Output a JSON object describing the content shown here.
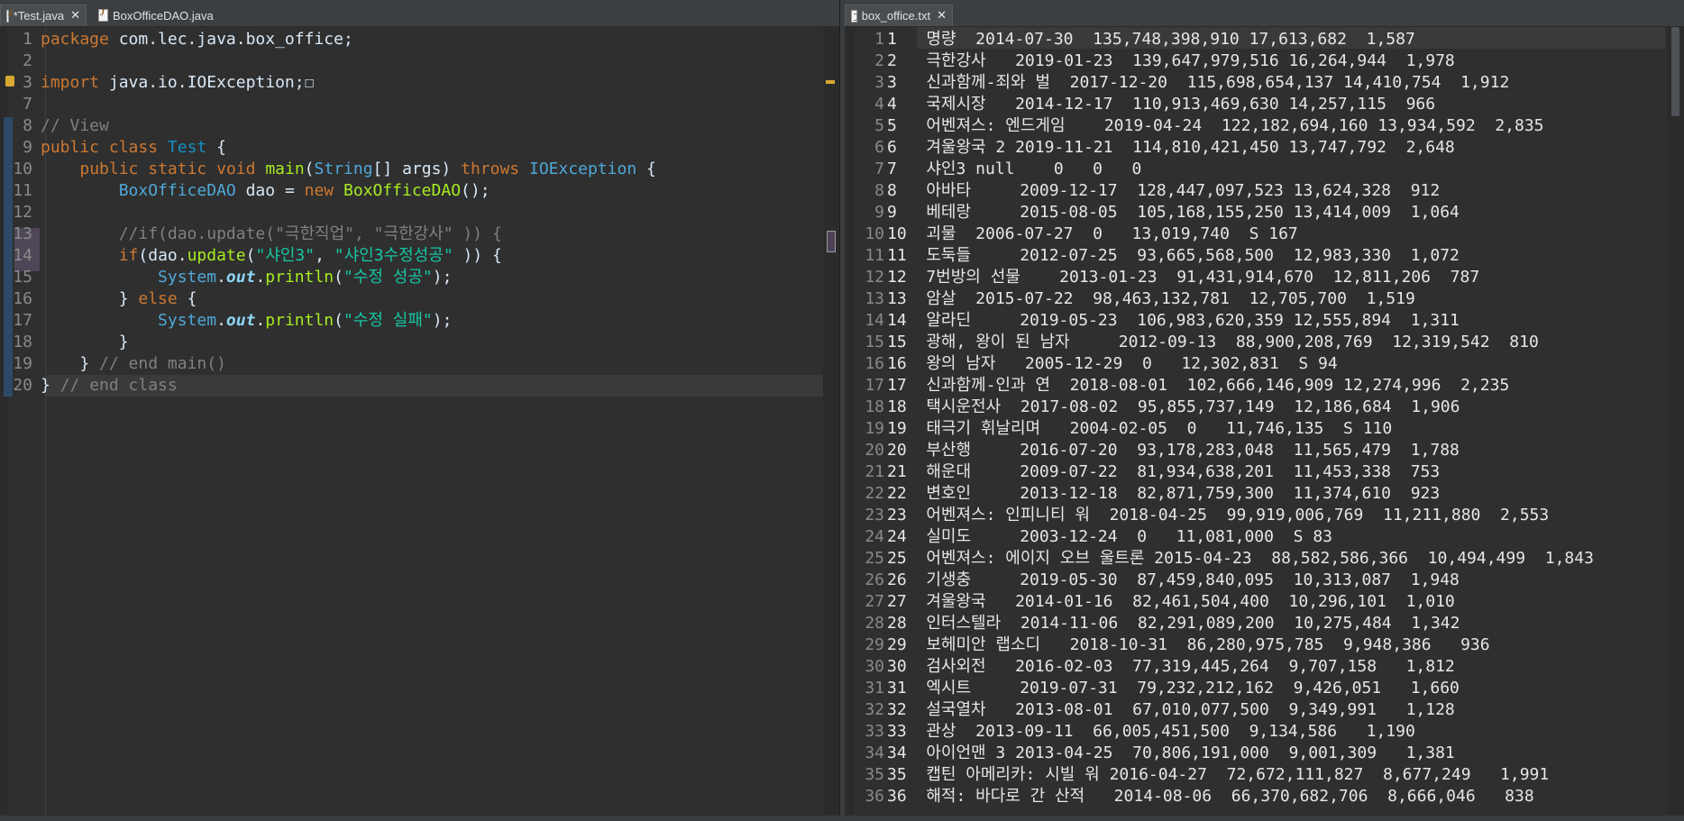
{
  "left_tabs": [
    {
      "label": "*Test.java",
      "close": "✕"
    },
    {
      "label": "BoxOfficeDAO.java"
    }
  ],
  "right_tabs": [
    {
      "label": "box_office.txt",
      "close": "✕"
    }
  ],
  "colors": {
    "editor_bg": "#2f2f2f",
    "keyword": "#cc7832",
    "string": "#17c6a3",
    "comment": "#808080",
    "class": "#1290c3",
    "method": "#a7ec21"
  },
  "code_lines": [
    {
      "n": "1",
      "parts": [
        [
          "kw",
          "package"
        ],
        [
          "code",
          " com.lec.java.box_office;"
        ]
      ]
    },
    {
      "n": "2",
      "parts": []
    },
    {
      "n": "3",
      "parts": [
        [
          "kw",
          "import"
        ],
        [
          "code",
          " java.io.IOException;"
        ],
        [
          "code",
          "☐"
        ]
      ]
    },
    {
      "n": "7",
      "parts": []
    },
    {
      "n": "8",
      "parts": [
        [
          "cmt",
          "// View"
        ]
      ]
    },
    {
      "n": "9",
      "parts": [
        [
          "kw",
          "public"
        ],
        [
          "code",
          " "
        ],
        [
          "kw",
          "class"
        ],
        [
          "code",
          " "
        ],
        [
          "cls",
          "Test"
        ],
        [
          "code",
          " {"
        ]
      ]
    },
    {
      "n": "10",
      "parts": [
        [
          "code",
          "    "
        ],
        [
          "kw",
          "public"
        ],
        [
          "code",
          " "
        ],
        [
          "kw",
          "static"
        ],
        [
          "code",
          " "
        ],
        [
          "kw",
          "void"
        ],
        [
          "code",
          " "
        ],
        [
          "fn",
          "main"
        ],
        [
          "code",
          "("
        ],
        [
          "typ",
          "String"
        ],
        [
          "code",
          "[] "
        ],
        [
          "var",
          "args"
        ],
        [
          "code",
          ") "
        ],
        [
          "kw",
          "throws"
        ],
        [
          "code",
          " "
        ],
        [
          "typ",
          "IOException"
        ],
        [
          "code",
          " {"
        ]
      ]
    },
    {
      "n": "11",
      "parts": [
        [
          "code",
          "        "
        ],
        [
          "typ",
          "BoxOfficeDAO"
        ],
        [
          "code",
          " "
        ],
        [
          "var",
          "dao"
        ],
        [
          "code",
          " = "
        ],
        [
          "kw",
          "new"
        ],
        [
          "code",
          " "
        ],
        [
          "fn",
          "BoxOfficeDAO"
        ],
        [
          "code",
          "();"
        ]
      ]
    },
    {
      "n": "12",
      "parts": []
    },
    {
      "n": "13",
      "parts": [
        [
          "code",
          "        "
        ],
        [
          "cmt",
          "//if(dao.update(\"극한직업\", \"극한강사\" )) {"
        ]
      ]
    },
    {
      "n": "14",
      "parts": [
        [
          "code",
          "        "
        ],
        [
          "kw",
          "if"
        ],
        [
          "code",
          "(dao."
        ],
        [
          "fn",
          "update"
        ],
        [
          "code",
          "("
        ],
        [
          "str",
          "\"샤인3\""
        ],
        [
          "code",
          ", "
        ],
        [
          "str",
          "\"샤인3수정성공\""
        ],
        [
          "code",
          " )) {"
        ]
      ]
    },
    {
      "n": "15",
      "parts": [
        [
          "code",
          "            "
        ],
        [
          "typ",
          "System"
        ],
        [
          "code",
          "."
        ],
        [
          "fld",
          "out"
        ],
        [
          "code",
          "."
        ],
        [
          "fn",
          "println"
        ],
        [
          "code",
          "("
        ],
        [
          "str",
          "\"수정 성공\""
        ],
        [
          "code",
          ");"
        ]
      ]
    },
    {
      "n": "16",
      "parts": [
        [
          "code",
          "        } "
        ],
        [
          "kw",
          "else"
        ],
        [
          "code",
          " {"
        ]
      ]
    },
    {
      "n": "17",
      "parts": [
        [
          "code",
          "            "
        ],
        [
          "typ",
          "System"
        ],
        [
          "code",
          "."
        ],
        [
          "fld",
          "out"
        ],
        [
          "code",
          "."
        ],
        [
          "fn",
          "println"
        ],
        [
          "code",
          "("
        ],
        [
          "str",
          "\"수정 실패\""
        ],
        [
          "code",
          ");"
        ]
      ]
    },
    {
      "n": "18",
      "parts": [
        [
          "code",
          "        }"
        ]
      ]
    },
    {
      "n": "19",
      "parts": [
        [
          "code",
          "    } "
        ],
        [
          "cmt",
          "// end main()"
        ]
      ]
    },
    {
      "n": "20",
      "parts": [
        [
          "code",
          "} "
        ],
        [
          "cmt",
          "// end class"
        ]
      ]
    }
  ],
  "txt_lines": [
    {
      "n": "1",
      "text": "1   명량  2014-07-30  135,748,398,910 17,613,682  1,587"
    },
    {
      "n": "2",
      "text": "2   극한강사   2019-01-23  139,647,979,516 16,264,944  1,978"
    },
    {
      "n": "3",
      "text": "3   신과함께-죄와 벌  2017-12-20  115,698,654,137 14,410,754  1,912"
    },
    {
      "n": "4",
      "text": "4   국제시장   2014-12-17  110,913,469,630 14,257,115  966"
    },
    {
      "n": "5",
      "text": "5   어벤져스: 엔드게임    2019-04-24  122,182,694,160 13,934,592  2,835"
    },
    {
      "n": "6",
      "text": "6   겨울왕국 2 2019-11-21  114,810,421,450 13,747,792  2,648"
    },
    {
      "n": "7",
      "text": "7   샤인3 null    0   0   0"
    },
    {
      "n": "8",
      "text": "8   아바타     2009-12-17  128,447,097,523 13,624,328  912"
    },
    {
      "n": "9",
      "text": "9   베테랑     2015-08-05  105,168,155,250 13,414,009  1,064"
    },
    {
      "n": "10",
      "text": "10  괴물  2006-07-27  0   13,019,740  S 167"
    },
    {
      "n": "11",
      "text": "11  도둑들     2012-07-25  93,665,568,500  12,983,330  1,072"
    },
    {
      "n": "12",
      "text": "12  7번방의 선물    2013-01-23  91,431,914,670  12,811,206  787"
    },
    {
      "n": "13",
      "text": "13  암살  2015-07-22  98,463,132,781  12,705,700  1,519"
    },
    {
      "n": "14",
      "text": "14  알라딘     2019-05-23  106,983,620,359 12,555,894  1,311"
    },
    {
      "n": "15",
      "text": "15  광해, 왕이 된 남자     2012-09-13  88,900,208,769  12,319,542  810"
    },
    {
      "n": "16",
      "text": "16  왕의 남자   2005-12-29  0   12,302,831  S 94"
    },
    {
      "n": "17",
      "text": "17  신과함께-인과 연  2018-08-01  102,666,146,909 12,274,996  2,235"
    },
    {
      "n": "18",
      "text": "18  택시운전사  2017-08-02  95,855,737,149  12,186,684  1,906"
    },
    {
      "n": "19",
      "text": "19  태극기 휘날리며   2004-02-05  0   11,746,135  S 110"
    },
    {
      "n": "20",
      "text": "20  부산행     2016-07-20  93,178,283,048  11,565,479  1,788"
    },
    {
      "n": "21",
      "text": "21  해운대     2009-07-22  81,934,638,201  11,453,338  753"
    },
    {
      "n": "22",
      "text": "22  변호인     2013-12-18  82,871,759,300  11,374,610  923"
    },
    {
      "n": "23",
      "text": "23  어벤져스: 인피니티 워  2018-04-25  99,919,006,769  11,211,880  2,553"
    },
    {
      "n": "24",
      "text": "24  실미도     2003-12-24  0   11,081,000  S 83"
    },
    {
      "n": "25",
      "text": "25  어벤져스: 에이지 오브 울트론 2015-04-23  88,582,586,366  10,494,499  1,843"
    },
    {
      "n": "26",
      "text": "26  기생충     2019-05-30  87,459,840,095  10,313,087  1,948"
    },
    {
      "n": "27",
      "text": "27  겨울왕국   2014-01-16  82,461,504,400  10,296,101  1,010"
    },
    {
      "n": "28",
      "text": "28  인터스텔라  2014-11-06  82,291,089,200  10,275,484  1,342"
    },
    {
      "n": "29",
      "text": "29  보헤미안 랩소디   2018-10-31  86,280,975,785  9,948,386   936"
    },
    {
      "n": "30",
      "text": "30  검사외전   2016-02-03  77,319,445,264  9,707,158   1,812"
    },
    {
      "n": "31",
      "text": "31  엑시트     2019-07-31  79,232,212,162  9,426,051   1,660"
    },
    {
      "n": "32",
      "text": "32  설국열차   2013-08-01  67,010,077,500  9,349,991   1,128"
    },
    {
      "n": "33",
      "text": "33  관상  2013-09-11  66,005,451,500  9,134,586   1,190"
    },
    {
      "n": "34",
      "text": "34  아이언맨 3 2013-04-25  70,806,191,000  9,001,309   1,381"
    },
    {
      "n": "35",
      "text": "35  캡틴 아메리카: 시빌 워 2016-04-27  72,672,111,827  8,677,249   1,991"
    },
    {
      "n": "36",
      "text": "36  해적: 바다로 간 산적   2014-08-06  66,370,682,706  8,666,046   838"
    }
  ]
}
